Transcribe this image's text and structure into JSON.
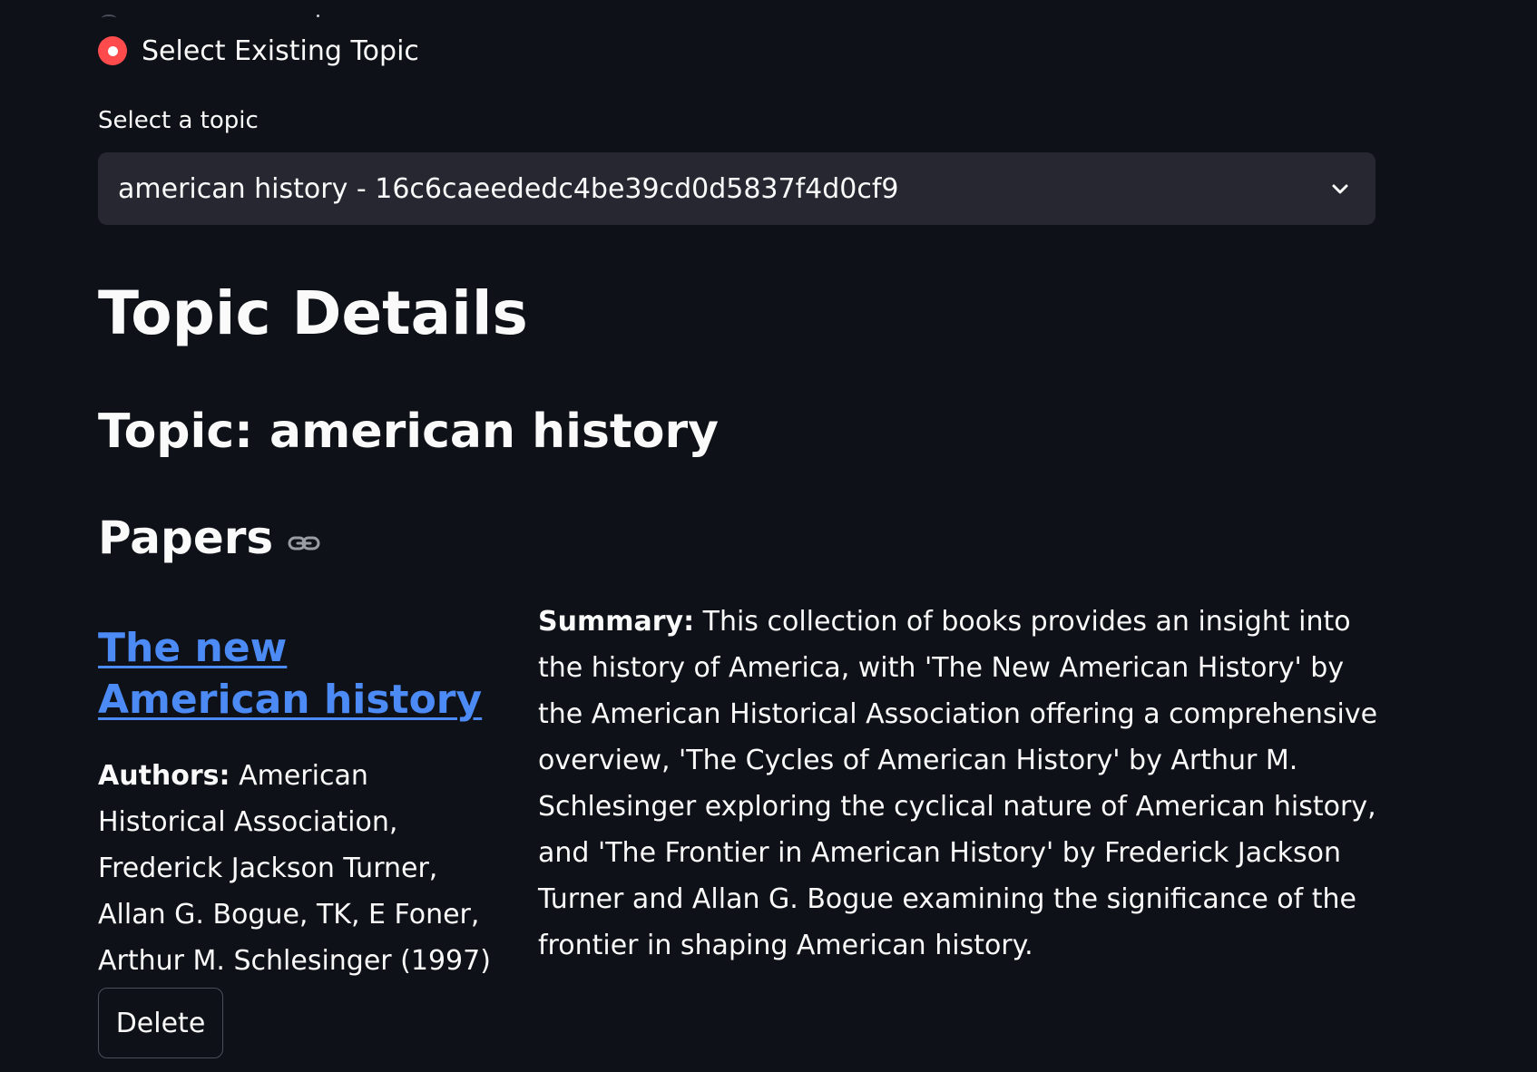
{
  "radio": {
    "label": "Select Existing Topic",
    "selected": true
  },
  "select": {
    "label": "Select a topic",
    "value": "american history - 16c6caeededc4be39cd0d5837f4d0cf9",
    "icon": "chevron-down-icon"
  },
  "headings": {
    "details": "Topic Details",
    "topic": "Topic: american history",
    "papers": "Papers",
    "papers_icon": "link-icon"
  },
  "paper": {
    "title": "The new American history",
    "authors_label": "Authors:",
    "authors": "American Historical Association, Frederick Jackson Turner, Allan G. Bogue, TK, E Foner, Arthur M. Schlesinger (1997)",
    "delete_label": "Delete",
    "summary_label": "Summary:",
    "summary": "This collection of books provides an insight into the history of America, with 'The New American History' by the American Historical Association offering a comprehensive overview, 'The Cycles of American History' by Arthur M. Schlesinger exploring the cyclical nature of American history, and 'The Frontier in American History' by Frederick Jackson Turner and Allan G. Bogue examining the significance of the frontier in shaping American history."
  },
  "colors": {
    "background": "#0e1117",
    "accent": "#ff4b4b",
    "link": "#4c8bf5",
    "input_bg": "#262730"
  }
}
